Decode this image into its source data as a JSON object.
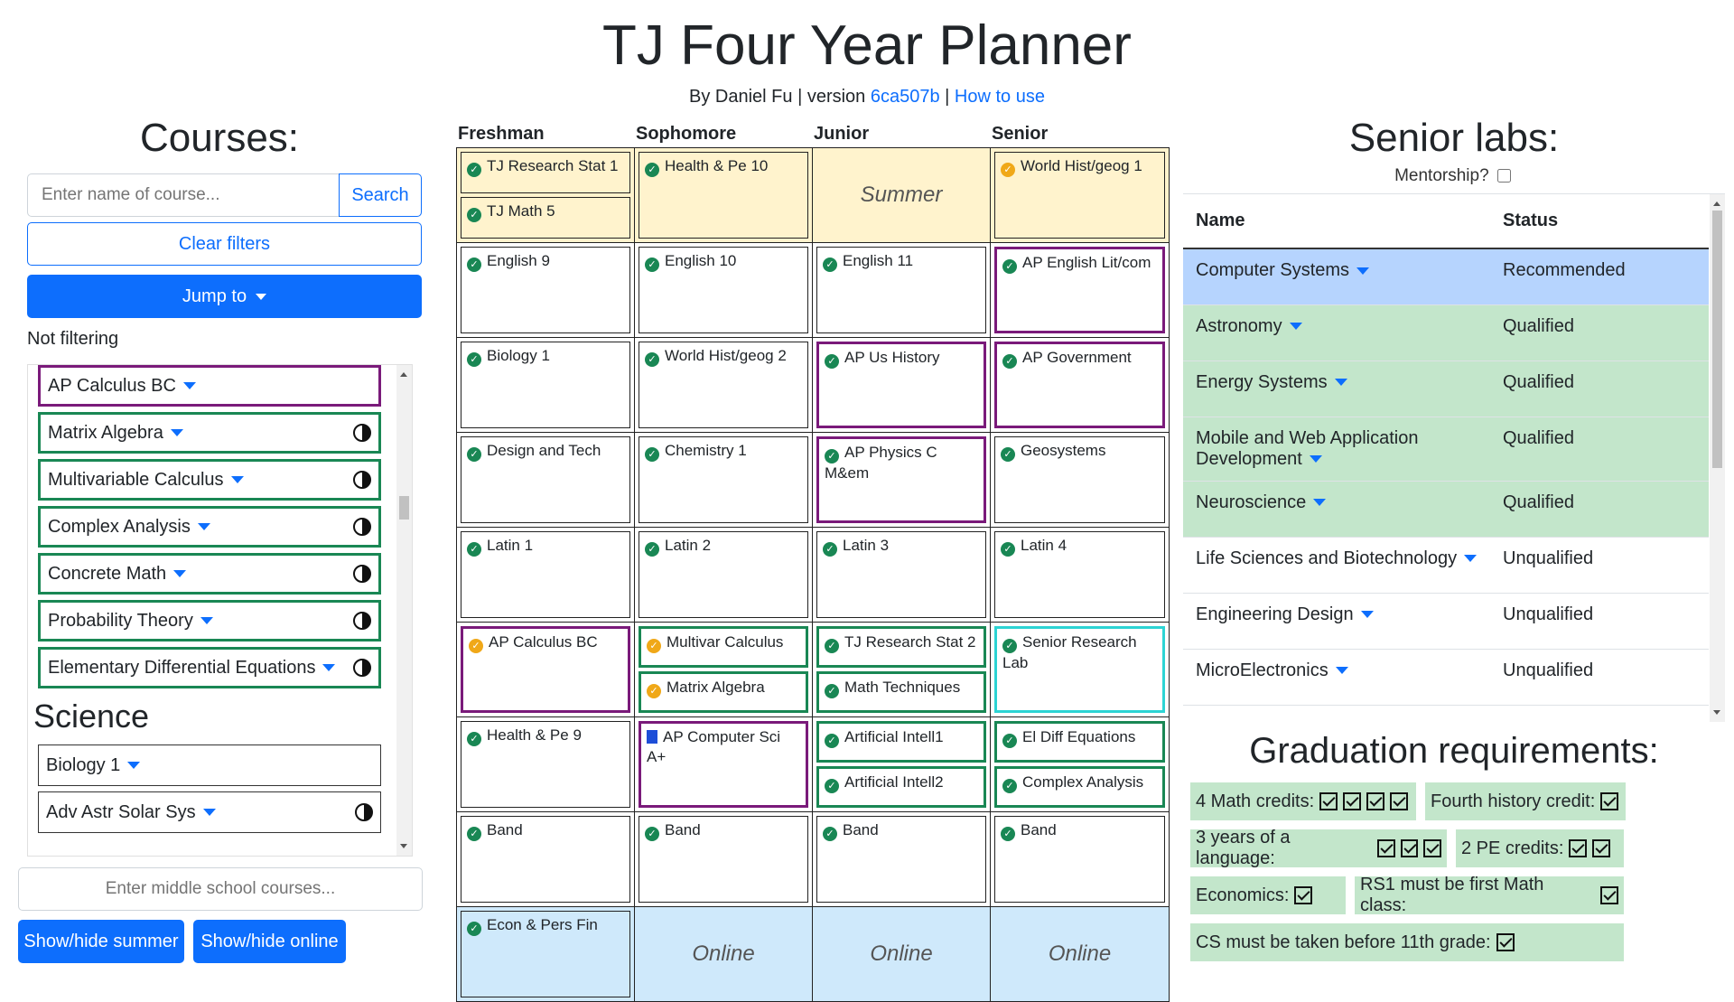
{
  "header": {
    "title": "TJ Four Year Planner",
    "byline_prefix": "By Daniel Fu | version ",
    "version": "6ca507b",
    "separator": " | ",
    "how_to_use": "How to use"
  },
  "courses": {
    "heading": "Courses:",
    "search_placeholder": "Enter name of course...",
    "search_label": "Search",
    "clear_label": "Clear filters",
    "jump_label": "Jump to",
    "filter_status": "Not filtering",
    "math_items": [
      {
        "name": "AP Calculus BC"
      },
      {
        "name": "Matrix Algebra"
      },
      {
        "name": "Multivariable Calculus"
      },
      {
        "name": "Complex Analysis"
      },
      {
        "name": "Concrete Math"
      },
      {
        "name": "Probability Theory"
      },
      {
        "name": "Elementary Differential Equations"
      }
    ],
    "science_heading": "Science",
    "science_items": [
      {
        "name": "Biology 1"
      },
      {
        "name": "Adv Astr Solar Sys"
      }
    ],
    "middle_school_placeholder": "Enter middle school courses...",
    "show_summer_label": "Show/hide summer",
    "show_online_label": "Show/hide online"
  },
  "planner": {
    "years": [
      "Freshman",
      "Sophomore",
      "Junior",
      "Senior"
    ],
    "rows": [
      [
        {
          "courses": [
            "TJ Research Stat 1",
            "TJ Math 5"
          ]
        },
        {
          "courses": [
            "Health & Pe 10"
          ]
        },
        {
          "empty": "Summer"
        },
        {
          "courses": [
            "World Hist/geog 1"
          ]
        }
      ],
      [
        {
          "courses": [
            "English 9"
          ]
        },
        {
          "courses": [
            "English 10"
          ]
        },
        {
          "courses": [
            "English 11"
          ]
        },
        {
          "courses": [
            "AP English Lit/com"
          ]
        }
      ],
      [
        {
          "courses": [
            "Biology 1"
          ]
        },
        {
          "courses": [
            "World Hist/geog 2"
          ]
        },
        {
          "courses": [
            "AP Us History"
          ]
        },
        {
          "courses": [
            "AP Government"
          ]
        }
      ],
      [
        {
          "courses": [
            "Design and Tech"
          ]
        },
        {
          "courses": [
            "Chemistry 1"
          ]
        },
        {
          "courses": [
            "AP Physics C M&em"
          ]
        },
        {
          "courses": [
            "Geosystems"
          ]
        }
      ],
      [
        {
          "courses": [
            "Latin 1"
          ]
        },
        {
          "courses": [
            "Latin 2"
          ]
        },
        {
          "courses": [
            "Latin 3"
          ]
        },
        {
          "courses": [
            "Latin 4"
          ]
        }
      ],
      [
        {
          "courses": [
            "AP Calculus BC"
          ]
        },
        {
          "courses": [
            "Multivar Calculus",
            "Matrix Algebra"
          ]
        },
        {
          "courses": [
            "TJ Research Stat 2",
            "Math Techniques"
          ]
        },
        {
          "courses": [
            "Senior Research Lab"
          ]
        }
      ],
      [
        {
          "courses": [
            "Health & Pe 9"
          ]
        },
        {
          "courses": [
            "AP Computer Sci A+"
          ]
        },
        {
          "courses": [
            "Artificial Intell1",
            "Artificial Intell2"
          ]
        },
        {
          "courses": [
            "El Diff Equations",
            "Complex Analysis"
          ]
        }
      ],
      [
        {
          "courses": [
            "Band"
          ]
        },
        {
          "courses": [
            "Band"
          ]
        },
        {
          "courses": [
            "Band"
          ]
        },
        {
          "courses": [
            "Band"
          ]
        }
      ],
      [
        {
          "courses": [
            "Econ & Pers Fin"
          ]
        },
        {
          "empty": "Online"
        },
        {
          "empty": "Online"
        },
        {
          "empty": "Online"
        }
      ]
    ]
  },
  "labs": {
    "heading": "Senior labs:",
    "mentorship_label": "Mentorship?",
    "col_name": "Name",
    "col_status": "Status",
    "rows": [
      {
        "name": "Computer Systems",
        "status": "Recommended"
      },
      {
        "name": "Astronomy",
        "status": "Qualified"
      },
      {
        "name": "Energy Systems",
        "status": "Qualified"
      },
      {
        "name": "Mobile and Web Application Development",
        "status": "Qualified"
      },
      {
        "name": "Neuroscience",
        "status": "Qualified"
      },
      {
        "name": "Life Sciences and Biotechnology",
        "status": "Unqualified"
      },
      {
        "name": "Engineering Design",
        "status": "Unqualified"
      },
      {
        "name": "MicroElectronics",
        "status": "Unqualified"
      }
    ]
  },
  "graduation": {
    "heading": "Graduation requirements:",
    "reqs": [
      {
        "label": "4 Math credits:",
        "checks": 4
      },
      {
        "label": "Fourth history credit:",
        "checks": 1
      },
      {
        "label": "3 years of a language:",
        "checks": 3
      },
      {
        "label": "2 PE credits:",
        "checks": 2
      },
      {
        "label": "Economics:",
        "checks": 1
      },
      {
        "label": "RS1 must be first Math class:",
        "checks": 1
      },
      {
        "label": "CS must be taken before 11th grade:",
        "checks": 1
      }
    ]
  },
  "colors": {
    "accent": "#0d6efd",
    "complete": "#198754",
    "warning": "#f0a818",
    "ap_border": "#7a1a7a",
    "research_border": "#2dd4d4",
    "summer_bg": "#fff3cd",
    "online_bg": "#cfe9fb",
    "recommended_bg": "#b6d4fe",
    "qualified_bg": "#c3e6cb"
  }
}
